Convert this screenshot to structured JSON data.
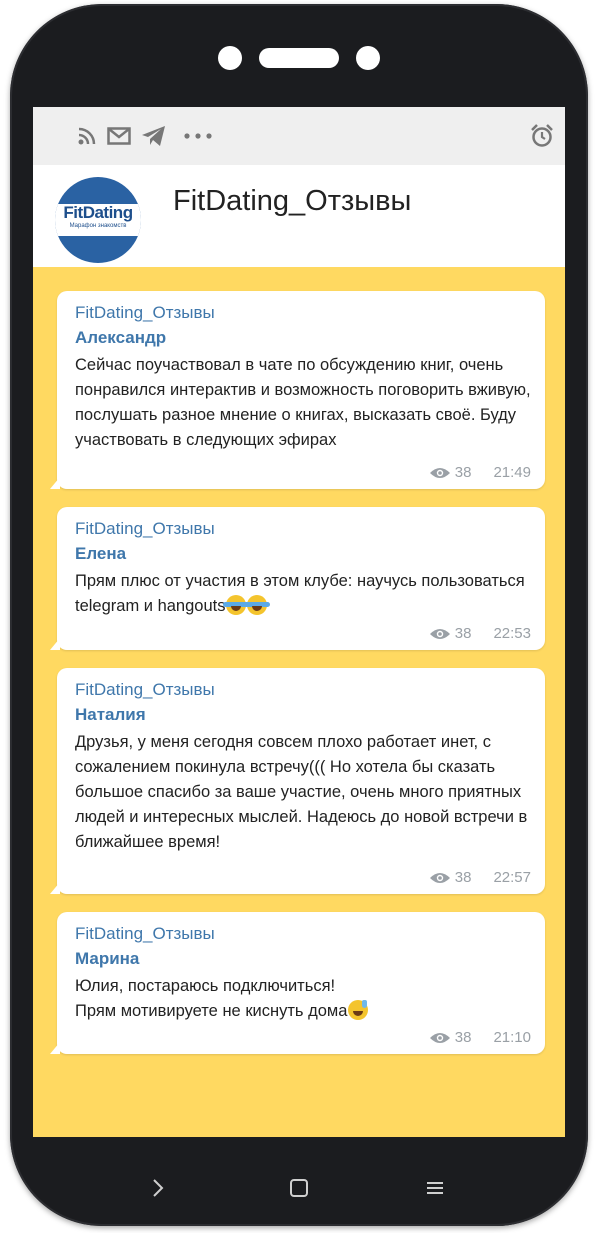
{
  "channel": {
    "title": "FitDating_Отзывы",
    "avatar_logo": "FitDating",
    "avatar_subtitle": "Марафон знакомств"
  },
  "status_icons": [
    "rss-icon",
    "mail-icon",
    "telegram-icon",
    "more-dots-icon",
    "alarm-icon"
  ],
  "messages": [
    {
      "channel": "FitDating_Отзывы",
      "author": "Александр",
      "text": "Сейчас поучаствовал в чате по обсуждению книг, очень понравился интерактив и возможность поговорить вживую, послушать разное мнение о книгах, высказать своё. Буду участвовать в следующих эфирах",
      "views": "38",
      "time": "21:49"
    },
    {
      "channel": "FitDating_Отзывы",
      "author": "Елена",
      "text": "Прям плюс от участия в этом клубе: научусь пользоваться telegram и hangouts",
      "emoji": "tears-of-joy",
      "views": "38",
      "time": "22:53"
    },
    {
      "channel": "FitDating_Отзывы",
      "author": "Наталия",
      "text": "Друзья, у меня сегодня совсем плохо работает инет, с сожалением покинула встречу((( Но хотела бы сказать большое спасибо за ваше участие, очень много приятных людей и интересных мыслей. Надеюсь до новой встречи в ближайшее время!",
      "views": "38",
      "time": "22:57"
    },
    {
      "channel": "FitDating_Отзывы",
      "author": "Марина",
      "text_line1": "Юлия, постараюсь подключиться!",
      "text_line2": "Прям мотивируете не киснуть дома",
      "emoji": "grinning-sweat",
      "views": "38",
      "time": "21:10"
    }
  ],
  "navbar": [
    "back-chevron-icon",
    "home-square-icon",
    "menu-lines-icon"
  ],
  "colors": {
    "background": "#ffd961",
    "link": "#3f77ab",
    "phone_body": "#1b1c1f"
  }
}
